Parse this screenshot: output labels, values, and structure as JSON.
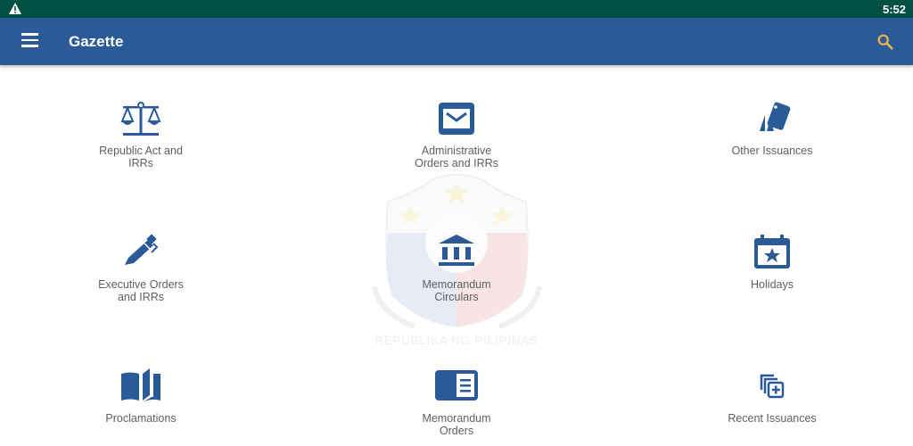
{
  "status_bar": {
    "time": "5:52",
    "alert_icon": "warning-icon"
  },
  "app_bar": {
    "title": "Gazette",
    "menu_icon": "hamburger-menu-icon",
    "search_icon": "search-icon"
  },
  "colors": {
    "status_bar": "#005143",
    "app_bar": "#2b5a98",
    "icon": "#2b5a98",
    "search_icon": "#e9b74a",
    "label": "#5f5f5f"
  },
  "watermark": {
    "text": "REPUBLIKA NG PILIPINAS",
    "icon": "philippine-seal-watermark"
  },
  "tiles": [
    {
      "label": "Republic Act and\nIRRs",
      "icon": "scales-of-justice-icon"
    },
    {
      "label": "Administrative\nOrders and IRRs",
      "icon": "envelope-icon"
    },
    {
      "label": "Other Issuances",
      "icon": "tags-icon"
    },
    {
      "label": "Executive Orders\nand IRRs",
      "icon": "pen-icon"
    },
    {
      "label": "Memorandum\nCirculars",
      "icon": "government-building-icon"
    },
    {
      "label": "Holidays",
      "icon": "calendar-star-icon"
    },
    {
      "label": "Proclamations",
      "icon": "open-book-icon"
    },
    {
      "label": "Memorandum\nOrders",
      "icon": "memo-card-icon"
    },
    {
      "label": "Recent Issuances",
      "icon": "stacked-add-icon"
    }
  ]
}
